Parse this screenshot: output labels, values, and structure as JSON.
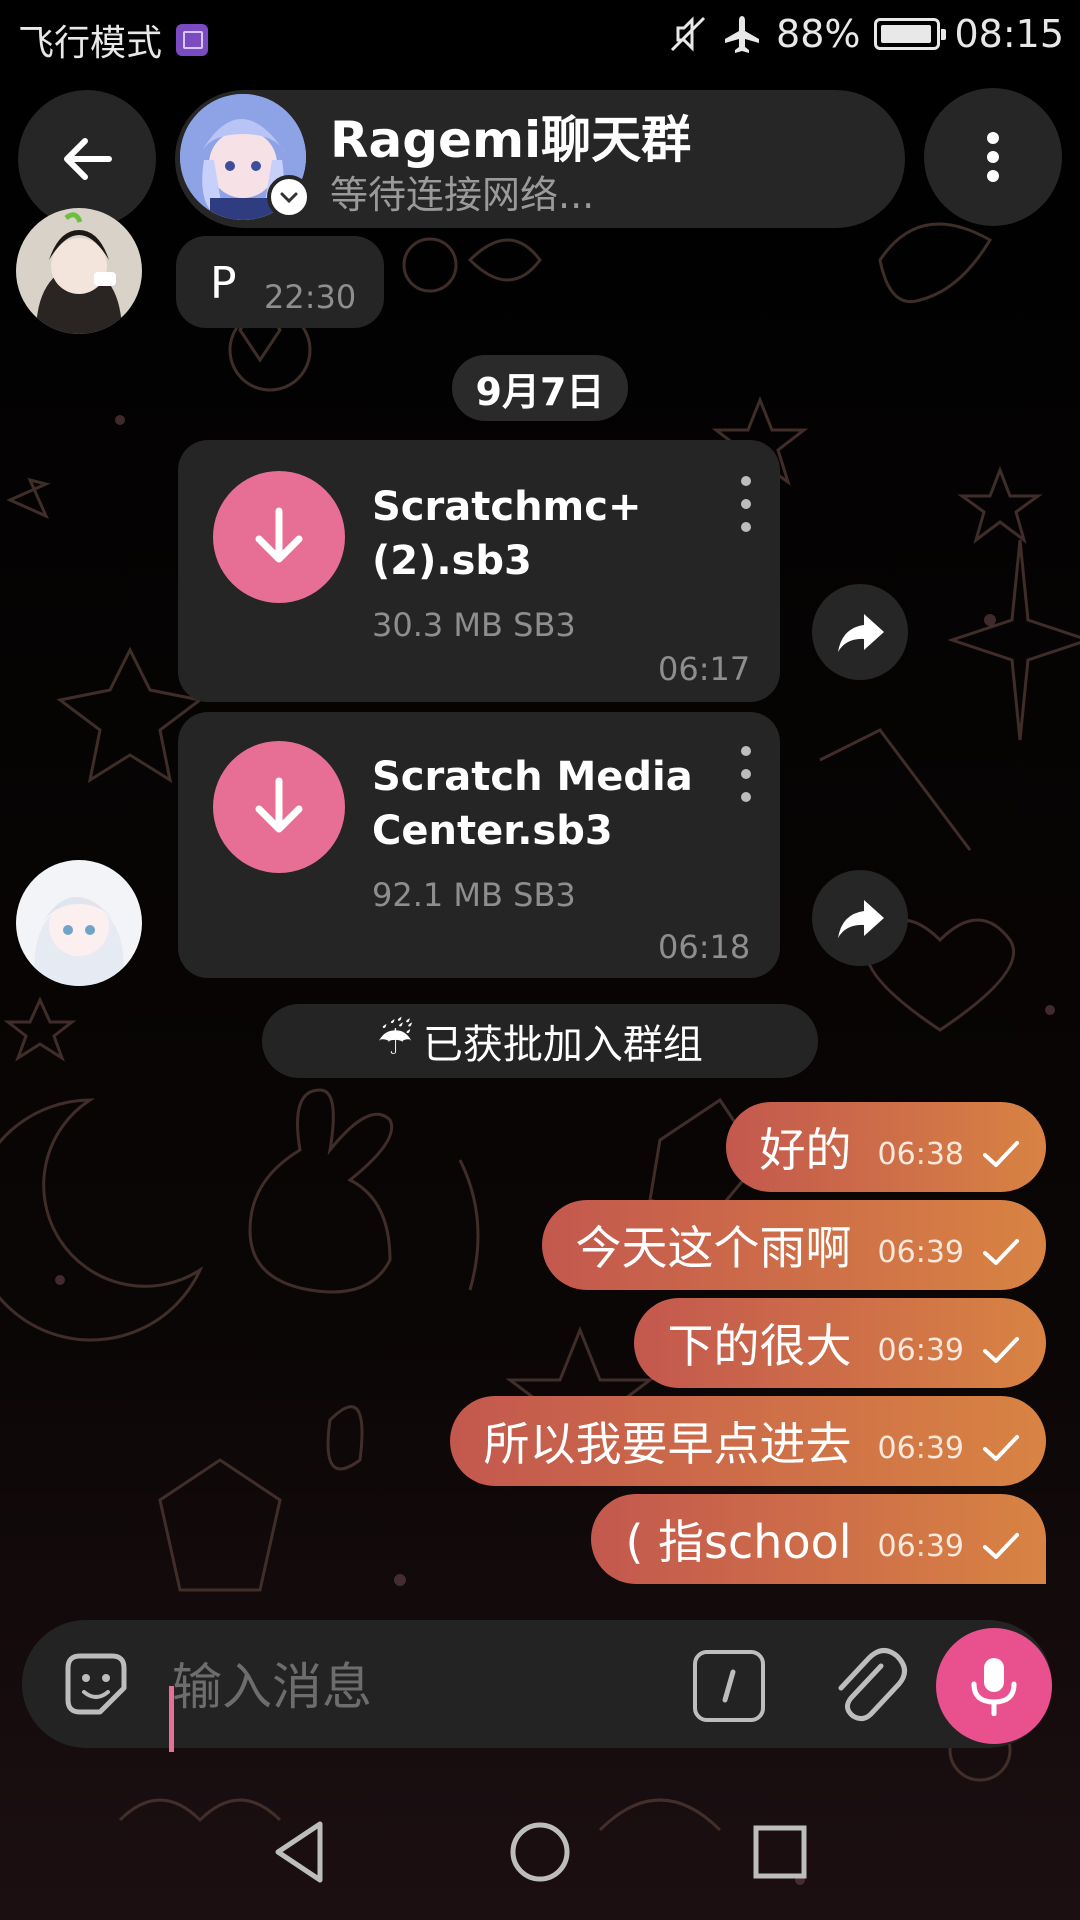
{
  "status_bar": {
    "airplane_mode_label": "飞行模式",
    "battery_percent": "88%",
    "time": "08:15",
    "icons": [
      "gallery-icon",
      "mute-icon",
      "airplane-icon",
      "battery-icon"
    ]
  },
  "header": {
    "group_name": "Ragemi聊天群",
    "status": "等待连接网络..."
  },
  "messages": {
    "p_msg": {
      "text": "P",
      "time": "22:30"
    },
    "date_divider": "9月7日",
    "file1": {
      "name_line1": "Scratchmc+",
      "name_line2": "(2).sb3",
      "size": "30.3 MB SB3",
      "time": "06:17"
    },
    "file2": {
      "name_line1": "Scratch Media",
      "name_line2": "Center.sb3",
      "size": "92.1 MB SB3",
      "time": "06:18"
    },
    "service": {
      "emoji": "☔",
      "text": "已获批加入群组"
    },
    "outgoing": [
      {
        "text": "好的",
        "time": "06:38"
      },
      {
        "text": "今天这个雨啊",
        "time": "06:39"
      },
      {
        "text": "下的很大",
        "time": "06:39"
      },
      {
        "text": "所以我要早点进去",
        "time": "06:39"
      },
      {
        "text": "( 指school",
        "time": "06:39"
      }
    ]
  },
  "composer": {
    "placeholder": "输入消息",
    "value": ""
  },
  "colors": {
    "accent_pink": "#e76f96",
    "mic_pink": "#e8508e",
    "bubble_out_start": "#c3584e",
    "bubble_out_end": "#d88343",
    "bubble_in": "#252525"
  }
}
